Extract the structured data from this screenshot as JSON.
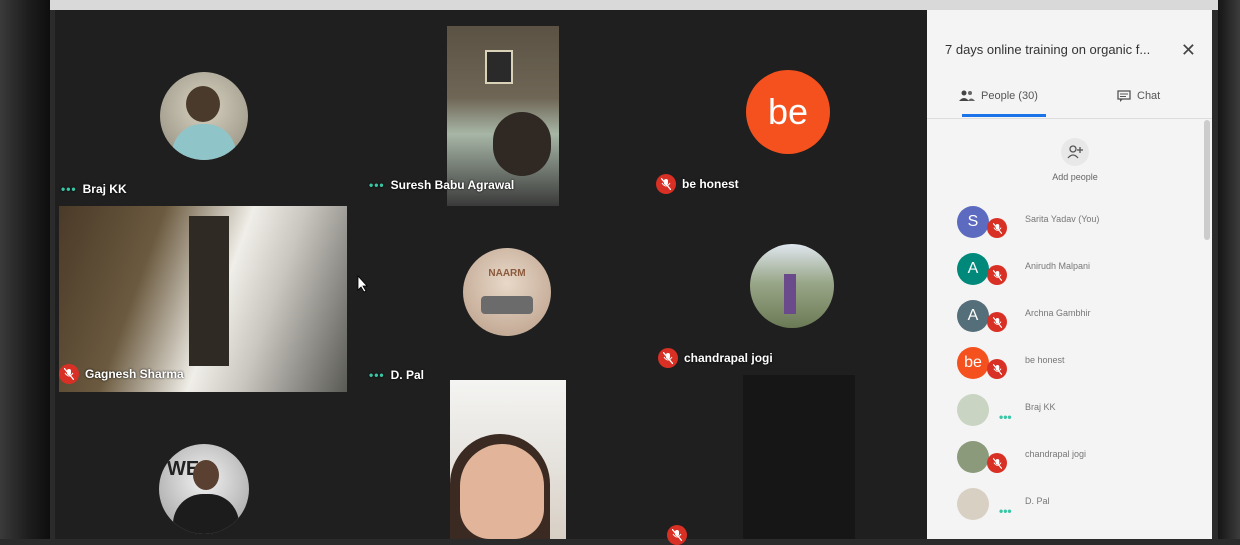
{
  "panel": {
    "title": "7 days online training on organic f...",
    "tabs": [
      {
        "label": "People (30)",
        "icon": "people-icon"
      },
      {
        "label": "Chat",
        "icon": "chat-icon"
      }
    ],
    "add_people_label": "Add people",
    "people": [
      {
        "name": "Sarita Yadav (You)",
        "initial": "S",
        "color": "#5c6bc0",
        "status": "muted"
      },
      {
        "name": "Anirudh Malpani",
        "initial": "A",
        "color": "#00897b",
        "status": "muted"
      },
      {
        "name": "Archna Gambhir",
        "initial": "A",
        "color": "#546e7a",
        "status": "muted"
      },
      {
        "name": "be honest",
        "initial": "be",
        "color": "#f4511e",
        "status": "muted"
      },
      {
        "name": "Braj KK",
        "initial": "",
        "color": "#c9d4c2",
        "status": "speaking"
      },
      {
        "name": "chandrapal jogi",
        "initial": "",
        "color": "#8a9a7a",
        "status": "muted"
      },
      {
        "name": "D. Pal",
        "initial": "",
        "color": "#d9d0c4",
        "status": "speaking"
      }
    ]
  },
  "tiles": [
    {
      "name": "Braj KK",
      "status": "speaking"
    },
    {
      "name": "Suresh Babu Agrawal",
      "status": "speaking"
    },
    {
      "name": "be honest",
      "status": "muted",
      "avatar_text": "be"
    },
    {
      "name": "Gagnesh Sharma",
      "status": "muted"
    },
    {
      "name": "D. Pal",
      "status": "speaking",
      "avatar_text": "NAARM"
    },
    {
      "name": "chandrapal jogi",
      "status": "muted"
    },
    {
      "name": "",
      "status": "none",
      "avatar_text": "WE"
    },
    {
      "name": "",
      "status": "none"
    },
    {
      "name": "",
      "status": "muted"
    }
  ],
  "colors": {
    "muted": "#d93025",
    "speaking": "#38c6a6",
    "accent": "#1a73e8",
    "be_avatar": "#f4511e"
  }
}
